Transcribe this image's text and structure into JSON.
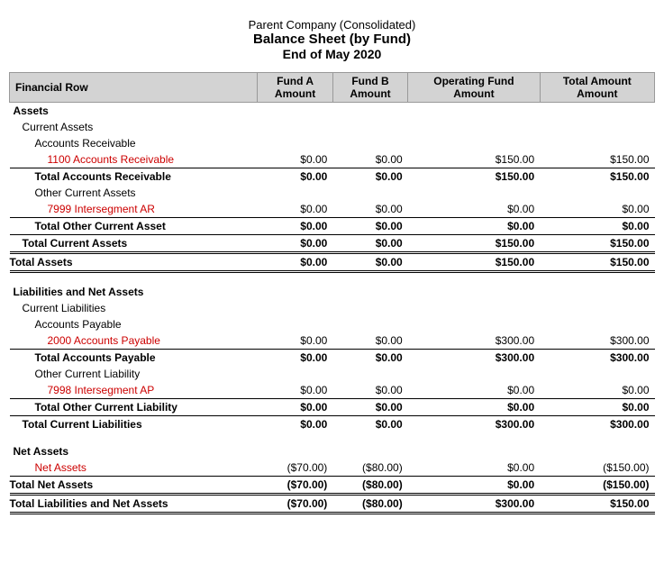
{
  "title": {
    "line1": "Parent Company (Consolidated)",
    "line2": "Balance Sheet (by Fund)",
    "line3": "End of May 2020"
  },
  "headers": {
    "col1": "Financial Row",
    "col2_line1": "Fund A",
    "col2_line2": "Amount",
    "col3_line1": "Fund B",
    "col3_line2": "Amount",
    "col4_line1": "Operating Fund",
    "col4_line2": "Amount",
    "col5_line1": "Total Amount",
    "col5_line2": "Amount"
  },
  "rows": [
    {
      "id": "assets-header",
      "label": "Assets",
      "indent": 0,
      "bold": true,
      "type": "section-header",
      "v1": "",
      "v2": "",
      "v3": "",
      "v4": ""
    },
    {
      "id": "current-assets-header",
      "label": "Current Assets",
      "indent": 1,
      "bold": false,
      "type": "sub-header",
      "v1": "",
      "v2": "",
      "v3": "",
      "v4": ""
    },
    {
      "id": "ar-header",
      "label": "Accounts Receivable",
      "indent": 2,
      "bold": false,
      "type": "sub-header",
      "v1": "",
      "v2": "",
      "v3": "",
      "v4": ""
    },
    {
      "id": "ar-1100",
      "label": "1100 Accounts Receivable",
      "indent": 3,
      "bold": false,
      "type": "detail-link",
      "v1": "$0.00",
      "v2": "$0.00",
      "v3": "$150.00",
      "v4": "$150.00"
    },
    {
      "id": "total-ar",
      "label": "Total Accounts Receivable",
      "indent": 2,
      "bold": true,
      "type": "subtotal",
      "v1": "$0.00",
      "v2": "$0.00",
      "v3": "$150.00",
      "v4": "$150.00",
      "border_top": true
    },
    {
      "id": "other-current-assets",
      "label": "Other Current Assets",
      "indent": 2,
      "bold": false,
      "type": "sub-header",
      "v1": "",
      "v2": "",
      "v3": "",
      "v4": ""
    },
    {
      "id": "ar-7999",
      "label": "7999 Intersegment AR",
      "indent": 3,
      "bold": false,
      "type": "detail-link",
      "v1": "$0.00",
      "v2": "$0.00",
      "v3": "$0.00",
      "v4": "$0.00"
    },
    {
      "id": "total-other-current-asset",
      "label": "Total Other Current Asset",
      "indent": 2,
      "bold": true,
      "type": "subtotal",
      "v1": "$0.00",
      "v2": "$0.00",
      "v3": "$0.00",
      "v4": "$0.00",
      "border_top": true
    },
    {
      "id": "total-current-assets",
      "label": "Total Current Assets",
      "indent": 1,
      "bold": true,
      "type": "subtotal",
      "v1": "$0.00",
      "v2": "$0.00",
      "v3": "$150.00",
      "v4": "$150.00",
      "border_top": true
    },
    {
      "id": "total-assets",
      "label": "Total Assets",
      "indent": 0,
      "bold": true,
      "type": "total",
      "v1": "$0.00",
      "v2": "$0.00",
      "v3": "$150.00",
      "v4": "$150.00",
      "double_border": true
    },
    {
      "id": "spacer1",
      "label": "",
      "type": "spacer",
      "v1": "",
      "v2": "",
      "v3": "",
      "v4": ""
    },
    {
      "id": "liabilities-header",
      "label": "Liabilities and Net Assets",
      "indent": 0,
      "bold": true,
      "type": "section-header",
      "v1": "",
      "v2": "",
      "v3": "",
      "v4": ""
    },
    {
      "id": "current-liab-header",
      "label": "Current Liabilities",
      "indent": 1,
      "bold": false,
      "type": "sub-header",
      "v1": "",
      "v2": "",
      "v3": "",
      "v4": ""
    },
    {
      "id": "ap-header",
      "label": "Accounts Payable",
      "indent": 2,
      "bold": false,
      "type": "sub-header",
      "v1": "",
      "v2": "",
      "v3": "",
      "v4": ""
    },
    {
      "id": "ap-2000",
      "label": "2000 Accounts Payable",
      "indent": 3,
      "bold": false,
      "type": "detail-link",
      "v1": "$0.00",
      "v2": "$0.00",
      "v3": "$300.00",
      "v4": "$300.00"
    },
    {
      "id": "total-ap",
      "label": "Total Accounts Payable",
      "indent": 2,
      "bold": true,
      "type": "subtotal",
      "v1": "$0.00",
      "v2": "$0.00",
      "v3": "$300.00",
      "v4": "$300.00",
      "border_top": true
    },
    {
      "id": "other-current-liab",
      "label": "Other Current Liability",
      "indent": 2,
      "bold": false,
      "type": "sub-header",
      "v1": "",
      "v2": "",
      "v3": "",
      "v4": ""
    },
    {
      "id": "ap-7998",
      "label": "7998 Intersegment AP",
      "indent": 3,
      "bold": false,
      "type": "detail-link",
      "v1": "$0.00",
      "v2": "$0.00",
      "v3": "$0.00",
      "v4": "$0.00"
    },
    {
      "id": "total-other-current-liab",
      "label": "Total Other Current Liability",
      "indent": 2,
      "bold": true,
      "type": "subtotal",
      "v1": "$0.00",
      "v2": "$0.00",
      "v3": "$0.00",
      "v4": "$0.00",
      "border_top": true
    },
    {
      "id": "total-current-liab",
      "label": "Total Current Liabilities",
      "indent": 1,
      "bold": true,
      "type": "subtotal",
      "v1": "$0.00",
      "v2": "$0.00",
      "v3": "$300.00",
      "v4": "$300.00",
      "border_top": true
    },
    {
      "id": "spacer2",
      "label": "",
      "type": "spacer",
      "v1": "",
      "v2": "",
      "v3": "",
      "v4": ""
    },
    {
      "id": "net-assets-header",
      "label": "Net Assets",
      "indent": 0,
      "bold": true,
      "type": "section-header",
      "v1": "",
      "v2": "",
      "v3": "",
      "v4": ""
    },
    {
      "id": "net-assets-link",
      "label": "Net Assets",
      "indent": 2,
      "bold": false,
      "type": "detail-link",
      "v1": "($70.00)",
      "v2": "($80.00)",
      "v3": "$0.00",
      "v4": "($150.00)"
    },
    {
      "id": "total-net-assets",
      "label": "Total Net Assets",
      "indent": 0,
      "bold": true,
      "type": "total",
      "v1": "($70.00)",
      "v2": "($80.00)",
      "v3": "$0.00",
      "v4": "($150.00)",
      "border_top": true
    },
    {
      "id": "total-liab-net-assets",
      "label": "Total Liabilities and Net Assets",
      "indent": 0,
      "bold": true,
      "type": "grand-total",
      "v1": "($70.00)",
      "v2": "($80.00)",
      "v3": "$300.00",
      "v4": "$150.00",
      "double_border": true
    }
  ]
}
